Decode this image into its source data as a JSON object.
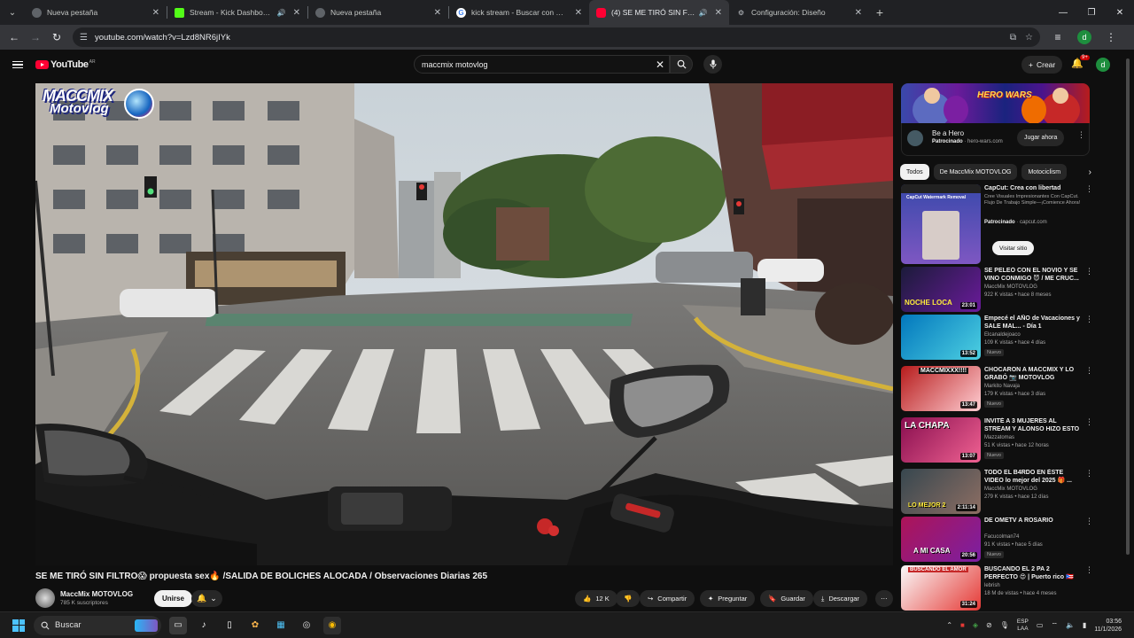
{
  "browser": {
    "tabs": [
      {
        "title": "Nueva pestaña",
        "active": false,
        "muted": false,
        "icon": "chrome-icon"
      },
      {
        "title": "Stream - Kick Dashboard",
        "active": false,
        "muted": true,
        "icon": "kick-icon"
      },
      {
        "title": "Nueva pestaña",
        "active": false,
        "muted": false,
        "icon": "chrome-icon"
      },
      {
        "title": "kick stream - Buscar con Google",
        "active": false,
        "muted": false,
        "icon": "google-icon"
      },
      {
        "title": "(4) SE ME TIRÓ SIN FILTRO😱",
        "active": true,
        "muted": true,
        "icon": "youtube-icon"
      },
      {
        "title": "Configuración: Diseño",
        "active": false,
        "muted": false,
        "icon": "settings-icon"
      }
    ],
    "url": "youtube.com/watch?v=Lzd8NR6jIYk",
    "profile_initial": "d"
  },
  "youtube": {
    "logo_text": "YouTube",
    "country_code": "AR",
    "search_query": "maccmix motovlog",
    "create_label": "Crear",
    "notifications": "9+",
    "avatar_initial": "d"
  },
  "video": {
    "title": "SE ME TIRÓ SIN FILTRO😱 propuesta sex🔥 /SALIDA DE BOLICHES ALOCADA / Observaciones Diarias 265",
    "channel_logo_line1": "MACCMIX",
    "channel_logo_line2": "Motovlog",
    "channel": "MaccMix MOTOVLOG",
    "subscribers": "785 K suscriptores",
    "join_label": "Unirse",
    "likes": "12 K",
    "share_label": "Compartir",
    "ask_label": "Preguntar",
    "save_label": "Guardar",
    "download_label": "Descargar"
  },
  "sidebar": {
    "ad": {
      "game_logo": "HERO WARS",
      "title": "Be a Hero",
      "sponsored": "Patrocinado",
      "domain": "hero-wars.com",
      "cta": "Jugar ahora"
    },
    "chips": [
      "Todos",
      "De MaccMix MOTOVLOG",
      "Motociclism"
    ],
    "ad_video": {
      "title": "CapCut: Crea con libertad",
      "description": "Cree Visuales Impresionantes Con CapCut. Flujo De Trabajo Simple—¡Comience Ahora!",
      "sponsored": "Patrocinado",
      "domain": "capcut.com",
      "cta": "Visitar sitio",
      "thumb_caption": "CapCut Watermark Removal"
    },
    "videos": [
      {
        "title": "SE PELEÓ CON EL NOVIO Y SE VINO CONMIGO 😈 / ME CRUC...",
        "channel": "MaccMix MOTOVLOG",
        "meta": "922 K vistas • hace 8 meses",
        "duration": "23:01",
        "nuevo": "",
        "thumb_text": "NOCHE LOCA",
        "color1": "#1b1b3a",
        "color2": "#6a1b9a"
      },
      {
        "title": "Empecé el AÑO de Vacaciones y SALE MAL... - Día 1",
        "channel": "Elcanaldejoaco",
        "meta": "109 K vistas • hace 4 días",
        "duration": "13:52",
        "nuevo": "Nuevo",
        "thumb_text": "",
        "color1": "#0277bd",
        "color2": "#4dd0e1"
      },
      {
        "title": "CHOCARON A MACCMIX Y LO GRABÓ 📷 MOTOVLOG",
        "channel": "Markito Navaja",
        "meta": "179 K vistas • hace 3 días",
        "duration": "13:47",
        "nuevo": "Nuevo",
        "thumb_text": "MACCMIXXX!!!!",
        "color1": "#b71c1c",
        "color2": "#ffcdd2"
      },
      {
        "title": "INVITÉ A 3 MUJERES AL STREAM Y ALONSO HIZO ESTO",
        "channel": "Mazzatomas",
        "meta": "51 K vistas • hace 12 horas",
        "duration": "13:07",
        "nuevo": "Nuevo",
        "thumb_text": "LA CHAPA",
        "color1": "#880e4f",
        "color2": "#f06292"
      },
      {
        "title": "TODO EL B4RDO EN ÉSTE VIDEO lo mejor del 2025 🎁 ...",
        "channel": "MaccMix MOTOVLOG",
        "meta": "279 K vistas • hace 12 días",
        "duration": "2:11:14",
        "nuevo": "",
        "thumb_text": "LO MEJOR 2",
        "color1": "#37474f",
        "color2": "#8d6e63"
      },
      {
        "title": "DE OMETV A ROSARIO",
        "channel": "Facucolman74",
        "meta": "91 K vistas • hace 5 días",
        "duration": "20:56",
        "nuevo": "Nuevo",
        "thumb_text": "A MI CASA",
        "color1": "#ad1457",
        "color2": "#7b1fa2"
      },
      {
        "title": "BUSCANDO EL 2 PA 2 PERFECTO 😍 | Puerto rico 🇵🇷",
        "channel": "lebrish",
        "meta": "18 M de vistas • hace 4 meses",
        "duration": "31:24",
        "nuevo": "",
        "thumb_text": "BUSCANDO EL AMOR",
        "color1": "#fafafa",
        "color2": "#e53935"
      }
    ]
  },
  "taskbar": {
    "search_label": "Buscar",
    "lang_line1": "ESP",
    "lang_line2": "LAA",
    "time": "03:56",
    "date": "11/1/2026"
  },
  "colors": {
    "youtube_red": "#ff0033",
    "background": "#0f0f0f",
    "chip_bg": "#272727",
    "windows_accent": "#4cc2ff"
  }
}
